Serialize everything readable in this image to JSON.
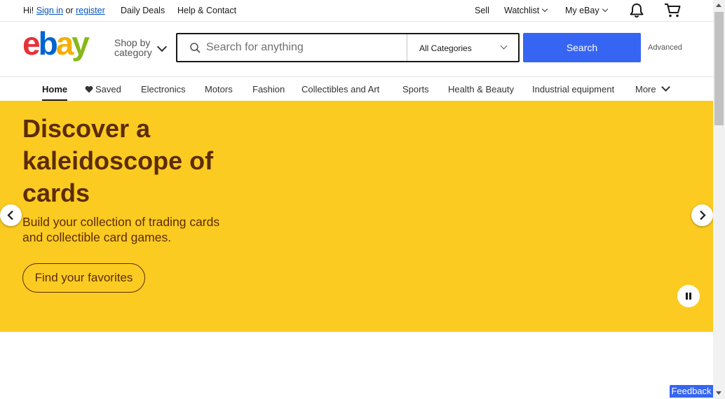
{
  "topbar": {
    "greeting": "Hi!",
    "sign_in": "Sign in",
    "or": "or",
    "register": "register",
    "daily_deals": "Daily Deals",
    "help_contact": "Help & Contact",
    "sell": "Sell",
    "watchlist": "Watchlist",
    "my_ebay": "My eBay"
  },
  "header": {
    "logo_letters": [
      "e",
      "b",
      "a",
      "y"
    ],
    "shop_by_line1": "Shop by",
    "shop_by_line2": "category",
    "search_placeholder": "Search for anything",
    "search_value": "",
    "category_selected": "All Categories",
    "search_button": "Search",
    "advanced": "Advanced"
  },
  "nav": {
    "items": [
      "Home",
      "Saved",
      "Electronics",
      "Motors",
      "Fashion",
      "Collectibles and Art",
      "Sports",
      "Health & Beauty",
      "Industrial equipment",
      "More"
    ]
  },
  "hero": {
    "title": "Discover a kaleidoscope of cards",
    "subtitle": "Build your collection of trading cards and collectible card games.",
    "cta": "Find your favorites",
    "background_color": "#fbcb22",
    "text_color": "#5c2c06"
  },
  "feedback": "Feedback",
  "icons": [
    "notification-bell-icon",
    "shopping-cart-icon",
    "search-icon",
    "heart-icon",
    "chevron-left-icon",
    "chevron-right-icon",
    "pause-icon"
  ],
  "colors": {
    "brand_blue": "#3665f3",
    "logo_red": "#e53238",
    "logo_blue": "#0064d2",
    "logo_yellow": "#f5af02",
    "logo_green": "#86b817"
  }
}
